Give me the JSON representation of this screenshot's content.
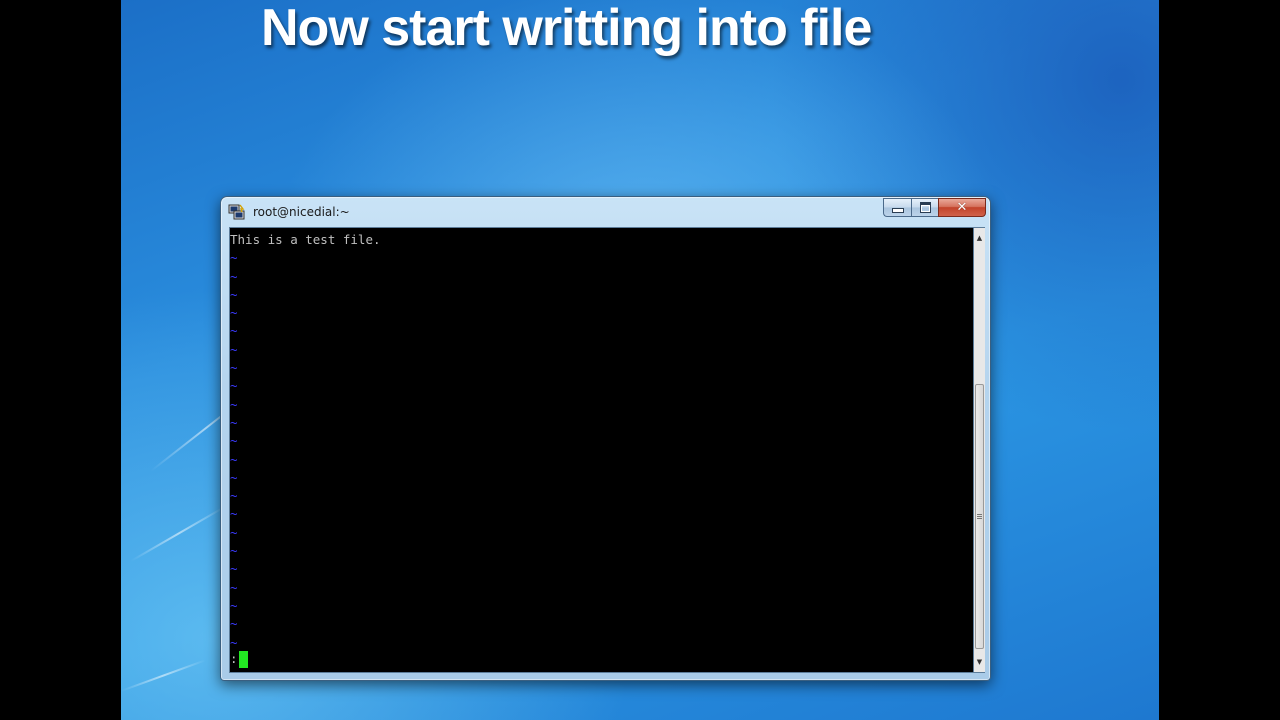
{
  "headline": "Now start writting into file",
  "bottom_caption": "",
  "window": {
    "title": "root@nicedial:~",
    "icon": "putty-icon",
    "controls": {
      "minimize_icon": "minimize-icon",
      "maximize_icon": "maximize-icon",
      "close_icon": "close-icon"
    }
  },
  "terminal": {
    "first_line": "This is a test file.",
    "empty_line_marker": "~",
    "empty_line_count": 22,
    "status_prefix": ":",
    "colors": {
      "background": "#000000",
      "text": "#c0c0c0",
      "tilde": "#3a3aff",
      "cursor": "#22e822"
    }
  },
  "scrollbar": {
    "up_icon": "arrow-up-icon",
    "down_icon": "arrow-down-icon",
    "grip_icon": "grip-icon"
  }
}
